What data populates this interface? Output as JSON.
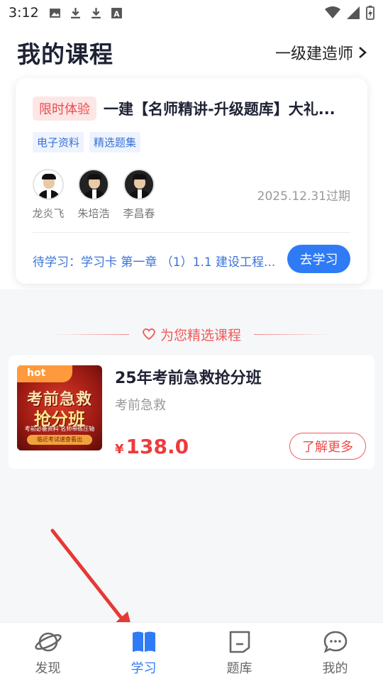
{
  "status_bar": {
    "time": "3:12",
    "icons": [
      "image-icon",
      "download-icon",
      "download-icon",
      "font-icon"
    ],
    "right_icons": [
      "wifi-icon",
      "signal-icon",
      "battery-charging-icon"
    ]
  },
  "header": {
    "title": "我的课程",
    "exam_selector": "一级建造师"
  },
  "course_card": {
    "badge": "限时体验",
    "title": "一建【名师精讲-升级题库】大礼...",
    "tags": [
      "电子资料",
      "精选题集"
    ],
    "teachers": [
      {
        "name": "龙炎飞"
      },
      {
        "name": "朱培浩"
      },
      {
        "name": "李昌春"
      }
    ],
    "expire": "2025.12.31过期",
    "pending": "待学习：学习卡 第一章 （1）1.1 建设工程...",
    "study_button": "去学习"
  },
  "recommend": {
    "heading": "为您精选课程",
    "product": {
      "hot_label": "hot",
      "thumb_line1": "考前急救",
      "thumb_line2": "抢分班",
      "thumb_sub": "考前必备资料  名师带练压轴",
      "thumb_banner": "临近考试速查看出",
      "title": "25年考前急救抢分班",
      "subtitle": "考前急救",
      "currency": "¥",
      "price": "138.0",
      "more_button": "了解更多"
    }
  },
  "bottom_nav": [
    {
      "label": "发现",
      "icon": "planet-icon",
      "active": false
    },
    {
      "label": "学习",
      "icon": "book-icon",
      "active": true
    },
    {
      "label": "题库",
      "icon": "question-bank-icon",
      "active": false
    },
    {
      "label": "我的",
      "icon": "chat-bubble-icon",
      "active": false
    }
  ],
  "colors": {
    "accent": "#2f7bf5",
    "price_red": "#ee3b3b",
    "annotation_arrow": "#e53935"
  }
}
